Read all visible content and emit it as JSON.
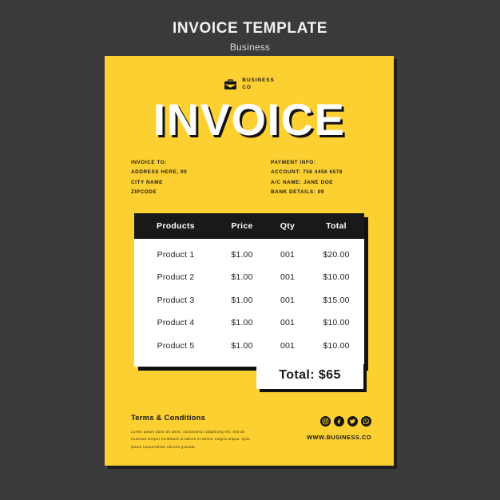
{
  "page_header": {
    "title": "INVOICE TEMPLATE",
    "subtitle": "Business"
  },
  "colors": {
    "background": "#3a3a3a",
    "card": "#fdd032",
    "ink": "#191919",
    "paper": "#ffffff"
  },
  "brand": {
    "icon": "briefcase-icon",
    "line1": "BUSINESS",
    "line2": "CO"
  },
  "title": "INVOICE",
  "invoice_to": {
    "heading": "INVOICE TO:",
    "address": "ADDRESS HERE, 00",
    "city": "CITY NAME",
    "zipcode": "ZIPCODE"
  },
  "payment_info": {
    "heading": "PAYMENT INFO:",
    "account": "ACCOUNT: 756 4456 6578",
    "ac_name": "A/C NAME: JANE DOE",
    "bank_details": "BANK DETAILS: 09"
  },
  "table": {
    "headers": [
      "Products",
      "Price",
      "Qty",
      "Total"
    ],
    "rows": [
      {
        "product": "Product 1",
        "price": "$1.00",
        "qty": "001",
        "total": "$20.00"
      },
      {
        "product": "Product 2",
        "price": "$1.00",
        "qty": "001",
        "total": "$10.00"
      },
      {
        "product": "Product 3",
        "price": "$1.00",
        "qty": "001",
        "total": "$15.00"
      },
      {
        "product": "Product 4",
        "price": "$1.00",
        "qty": "001",
        "total": "$10.00"
      },
      {
        "product": "Product 5",
        "price": "$1.00",
        "qty": "001",
        "total": "$10.00"
      }
    ]
  },
  "total": "Total: $65",
  "terms": {
    "title": "Terms & Conditions",
    "body": "Lorem ipsum dolor sit amet, consectetur adipiscing elit, sed do eiusmod tempor incididunt ut labore et dolore magna aliqua. Quis ipsum suspendisse ultrices gravida."
  },
  "footer": {
    "socials": [
      "instagram-icon",
      "facebook-icon",
      "twitter-icon",
      "whatsapp-icon"
    ],
    "website": "WWW.BUSINESS.CO"
  }
}
